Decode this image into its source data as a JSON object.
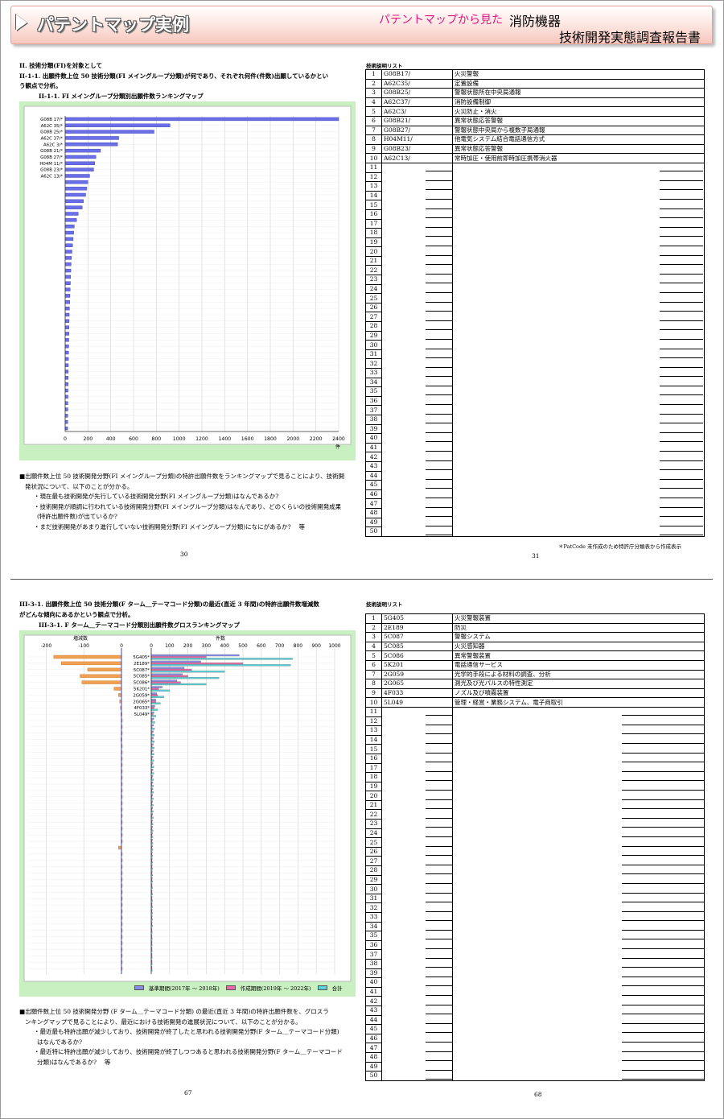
{
  "banner": {
    "title": "パテントマップ実例",
    "from": "パテントマップから見た",
    "topic": "消防機器",
    "report": "技術開発実態調査報告書"
  },
  "page1": {
    "heading": "II. 技術分類(FI)を対象として",
    "sub1": "II-1-1. 出願件数上位 50 技術分類(FI メイングループ分類)が何であり、それぞれ何件(件数)出願しているかとい",
    "sub2": "う観点で分析。",
    "chart_title": "II-1-1. FI メイングループ分類別出願件数ランキングマップ",
    "notes": [
      "■出願件数上位 50 技術開発分野(FI メイングループ分類)の特許出願件数をランキングマップで見ることにより、技術開",
      "発状況について、以下のことが分かる。",
      "・現在最も技術開発が先行している技術開発分野(FI メイングループ分類)はなんであるか?",
      "・技術開発が順調に行われている技術開発分野(FI メイングループ分類)はなんであり、どのくらいの技術開発成果",
      "(特許出願件数)が出ているか?",
      "・まだ技術開発があまり進行していない技術開発分野(FI メイングループ分類)になにがあるか?　 等"
    ],
    "page_left": "30",
    "page_right": "31",
    "list_title": "技術説明リスト",
    "footnote": "＊PatCode 未作成のため特許庁分類表から作成表示"
  },
  "page2": {
    "sub1": "III-3-1. 出願件数上位 50 技術分類(F ターム＿テーマコード分類)の最近(直近 3 年間)の特許出願件数増減数",
    "sub2": "がどんな傾向にあるかという観点で分析。",
    "chart_title": "III-3-1. F ターム＿テーマコード分類別出願件数グロスランキングマップ",
    "notes": [
      "■出願件数上位 50 技術開発分野 (F ターム＿テーマコード分類) の最近(直近 3 年間)の特許出願件数を、グロスラ",
      "ンキングマップで見ることにより、最近における技術開発の進展状況について、以下のことが分かる。",
      "・最近最も特許出願が減少しており、技術開発が終了したと思われる技術開発分野(F ターム＿テーマコード分類)",
      "はなんであるか?",
      "・最近特に特許出願が減少しており、技術開発が終了しつつあると思われる技術開発分野(F ターム＿テーマコード",
      "分類)はなんであるか?　 等"
    ],
    "page_left": "67",
    "page_right": "68",
    "list_title": "技術説明リスト",
    "legend": {
      "base": "基準期間(2017年 ～ 2018年)",
      "recent": "作成期間(2019年 ～ 2022年)",
      "total": "合計"
    }
  },
  "chart_data": [
    {
      "type": "bar",
      "title": "II-1-1. FI メイングループ分類別出願件数ランキングマップ",
      "xlabel": "件",
      "xlim": [
        0,
        2400
      ],
      "xticks": [
        "0",
        "200",
        "400",
        "600",
        "800",
        "1000",
        "1200",
        "1400",
        "1600",
        "1800",
        "2000",
        "2200",
        "2400"
      ],
      "categories": [
        "G08B 17/",
        "A62C 35/",
        "G08B 25/",
        "A62C 37/",
        "A62C 3/",
        "G08B 21/",
        "G08B 27/",
        "H04M 11/",
        "G08B 23/",
        "A62C 13/"
      ],
      "values": [
        2400,
        920,
        780,
        470,
        460,
        310,
        270,
        260,
        250,
        215,
        200,
        190,
        180,
        160,
        150,
        115,
        100,
        80,
        75,
        70,
        65,
        60,
        55,
        52,
        50,
        48,
        46,
        44,
        42,
        40,
        38,
        36,
        35,
        34,
        33,
        32,
        31,
        30,
        29,
        28,
        27,
        26,
        26,
        25,
        25,
        24,
        24,
        23,
        23,
        22
      ],
      "color": "#6a6ee8"
    },
    {
      "type": "bar",
      "title": "III-3-1. F ターム＿テーマコード分類別出願件数グロスランキングマップ",
      "left_axis_label": "増減数",
      "right_axis_label": "件数",
      "left_ticks": [
        "-200",
        "-100",
        "0"
      ],
      "right_ticks": [
        "0",
        "100",
        "200",
        "300",
        "400",
        "500",
        "600",
        "700",
        "800",
        "900",
        "1000"
      ],
      "categories": [
        "5G405",
        "2E189",
        "5C087",
        "5C085",
        "5C086",
        "5K201",
        "2G059",
        "2G065",
        "4F033",
        "5L049"
      ],
      "series": [
        {
          "name": "基準期間(2017年 ～ 2018年)",
          "color": "#8a8ee8",
          "values": [
            480,
            270,
            180,
            170,
            140,
            60,
            30,
            25,
            20,
            15,
            14,
            13,
            12,
            12,
            11,
            11,
            10,
            10,
            10,
            9,
            9,
            9,
            8,
            8,
            8,
            8,
            7,
            7,
            7,
            7,
            7,
            6,
            6,
            6,
            6,
            6,
            5,
            5,
            5,
            5,
            5,
            5,
            5,
            4,
            4,
            4,
            4,
            4,
            4,
            4
          ]
        },
        {
          "name": "作成期間(2019年 ～ 2022年)",
          "color": "#e86aa8",
          "values": [
            300,
            500,
            220,
            200,
            160,
            40,
            35,
            25,
            15,
            10,
            6,
            5,
            5,
            5,
            5,
            4,
            4,
            4,
            4,
            3,
            3,
            3,
            3,
            3,
            3,
            3,
            3,
            3,
            2,
            2,
            2,
            2,
            2,
            2,
            2,
            2,
            2,
            2,
            2,
            2,
            2,
            2,
            2,
            2,
            2,
            1,
            1,
            1,
            1,
            1
          ]
        },
        {
          "name": "合計",
          "color": "#5ad0d8",
          "values": [
            770,
            760,
            400,
            370,
            300,
            100,
            70,
            50,
            35,
            25,
            20,
            18,
            17,
            17,
            16,
            15,
            14,
            14,
            14,
            12,
            12,
            12,
            11,
            11,
            11,
            11,
            10,
            10,
            9,
            9,
            9,
            8,
            8,
            8,
            8,
            8,
            7,
            7,
            7,
            7,
            7,
            7,
            7,
            6,
            6,
            5,
            5,
            5,
            5,
            5
          ]
        },
        {
          "name": "増減数",
          "color": "#f0a050",
          "values": [
            -180,
            -160,
            -90,
            -110,
            -105,
            -20,
            -8,
            -5,
            -3,
            -2,
            -1,
            -1,
            -1,
            -2,
            -1,
            -1,
            -1,
            -1,
            -1,
            -1,
            -1,
            -1,
            -1,
            -1,
            -1,
            -1,
            -1,
            -1,
            -1,
            -1,
            -8,
            -1,
            -1,
            -1,
            -1,
            -1,
            -1,
            -1,
            -1,
            -1,
            -1,
            -1,
            -1,
            -1,
            -1,
            -1,
            -1,
            -1,
            -1,
            -1
          ]
        }
      ]
    }
  ],
  "list1": [
    {
      "code": "G08B17/",
      "desc": "火災警報"
    },
    {
      "code": "A62C35/",
      "desc": "定置設備"
    },
    {
      "code": "G08B25/",
      "desc": "警報状態所在中央局通報"
    },
    {
      "code": "A62C37/",
      "desc": "消防設備制御"
    },
    {
      "code": "A62C3/",
      "desc": "火災防止・消火"
    },
    {
      "code": "G08B21/",
      "desc": "異常状態応答警報"
    },
    {
      "code": "G08B27/",
      "desc": "警報状態中央局から複数子局通報"
    },
    {
      "code": "H04M11/",
      "desc": "他電気システム結合電話通信方式"
    },
    {
      "code": "G08B23/",
      "desc": "異常状態応答警報"
    },
    {
      "code": "A62C13/",
      "desc": "常時加圧・使用前即時加圧携帯消火器"
    }
  ],
  "list2": [
    {
      "code": "5G405",
      "desc": "火災警報装置"
    },
    {
      "code": "2E189",
      "desc": "防災"
    },
    {
      "code": "5C087",
      "desc": "警報システム"
    },
    {
      "code": "5C085",
      "desc": "火災感知器"
    },
    {
      "code": "5C086",
      "desc": "異常警報装置"
    },
    {
      "code": "5K201",
      "desc": "電話通信サービス"
    },
    {
      "code": "2G059",
      "desc": "光学的手段による材料の調査、分析"
    },
    {
      "code": "2G065",
      "desc": "測光及び光パルスの特性測定"
    },
    {
      "code": "4F033",
      "desc": "ノズル及び噴霧装置"
    },
    {
      "code": "5L049",
      "desc": "管理・経営・業務システム、電子商取引"
    }
  ]
}
